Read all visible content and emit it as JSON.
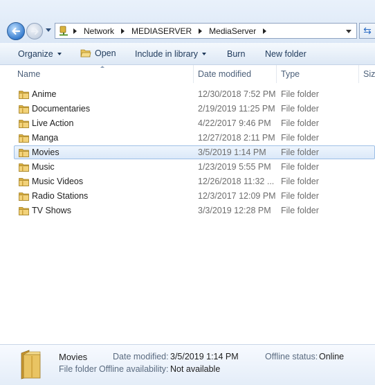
{
  "address": {
    "crumbs": [
      "Network",
      "MEDIASERVER",
      "MediaServer"
    ]
  },
  "toolbar": {
    "organize": "Organize",
    "open": "Open",
    "include_in_library": "Include in library",
    "burn": "Burn",
    "new_folder": "New folder"
  },
  "columns": {
    "name": "Name",
    "date_modified": "Date modified",
    "type": "Type",
    "size": "Size"
  },
  "files": [
    {
      "name": "Anime",
      "date": "12/30/2018 7:52 PM",
      "type": "File folder"
    },
    {
      "name": "Documentaries",
      "date": "2/19/2019 11:25 PM",
      "type": "File folder"
    },
    {
      "name": "Live Action",
      "date": "4/22/2017 9:46 PM",
      "type": "File folder"
    },
    {
      "name": "Manga",
      "date": "12/27/2018 2:11 PM",
      "type": "File folder"
    },
    {
      "name": "Movies",
      "date": "3/5/2019 1:14 PM",
      "type": "File folder",
      "selected": true
    },
    {
      "name": "Music",
      "date": "1/23/2019 5:55 PM",
      "type": "File folder"
    },
    {
      "name": "Music Videos",
      "date": "12/26/2018 11:32 ...",
      "type": "File folder"
    },
    {
      "name": "Radio Stations",
      "date": "12/3/2017 12:09 PM",
      "type": "File folder"
    },
    {
      "name": "TV Shows",
      "date": "3/3/2019 12:28 PM",
      "type": "File folder"
    }
  ],
  "details": {
    "name": "Movies",
    "kind": "File folder",
    "date_modified_label": "Date modified:",
    "date_modified_value": "3/5/2019 1:14 PM",
    "offline_availability_label": "Offline availability:",
    "offline_availability_value": "Not available",
    "offline_status_label": "Offline status:",
    "offline_status_value": "Online"
  },
  "colors": {
    "selection_fill": "#dbe9f9",
    "selection_border": "#9dbfe6",
    "folder": "#e8c35a"
  }
}
